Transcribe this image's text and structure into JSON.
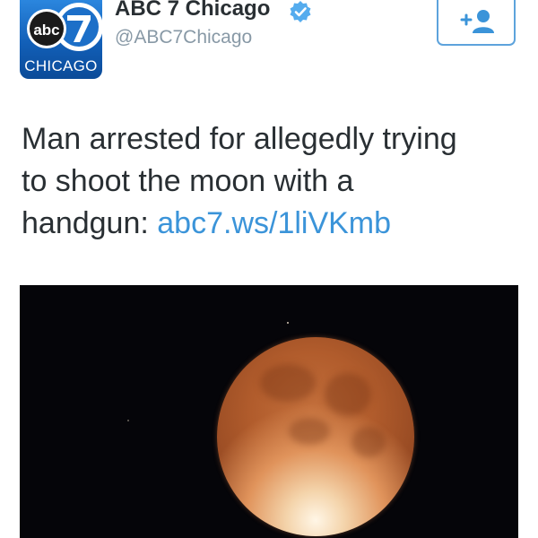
{
  "tweet": {
    "avatar": {
      "logo_text": "abc",
      "logo_number": "7",
      "city": "CHICAGO"
    },
    "display_name": "ABC 7 Chicago",
    "verified": true,
    "handle": "@ABC7Chicago",
    "follow_button_icon": "follow-person-plus-icon",
    "text_lines": [
      "Man arrested for allegedly trying",
      "to shoot the moon with a",
      "handgun: "
    ],
    "link_text": "abc7.ws/1liVKmb",
    "media": {
      "subject": "moon-photo"
    }
  },
  "colors": {
    "brand_blue": "#1a6bc4",
    "link_blue": "#3b94d9",
    "verified_blue": "#55acee",
    "handle_gray": "#8899a6",
    "text_dark": "#292f33"
  }
}
